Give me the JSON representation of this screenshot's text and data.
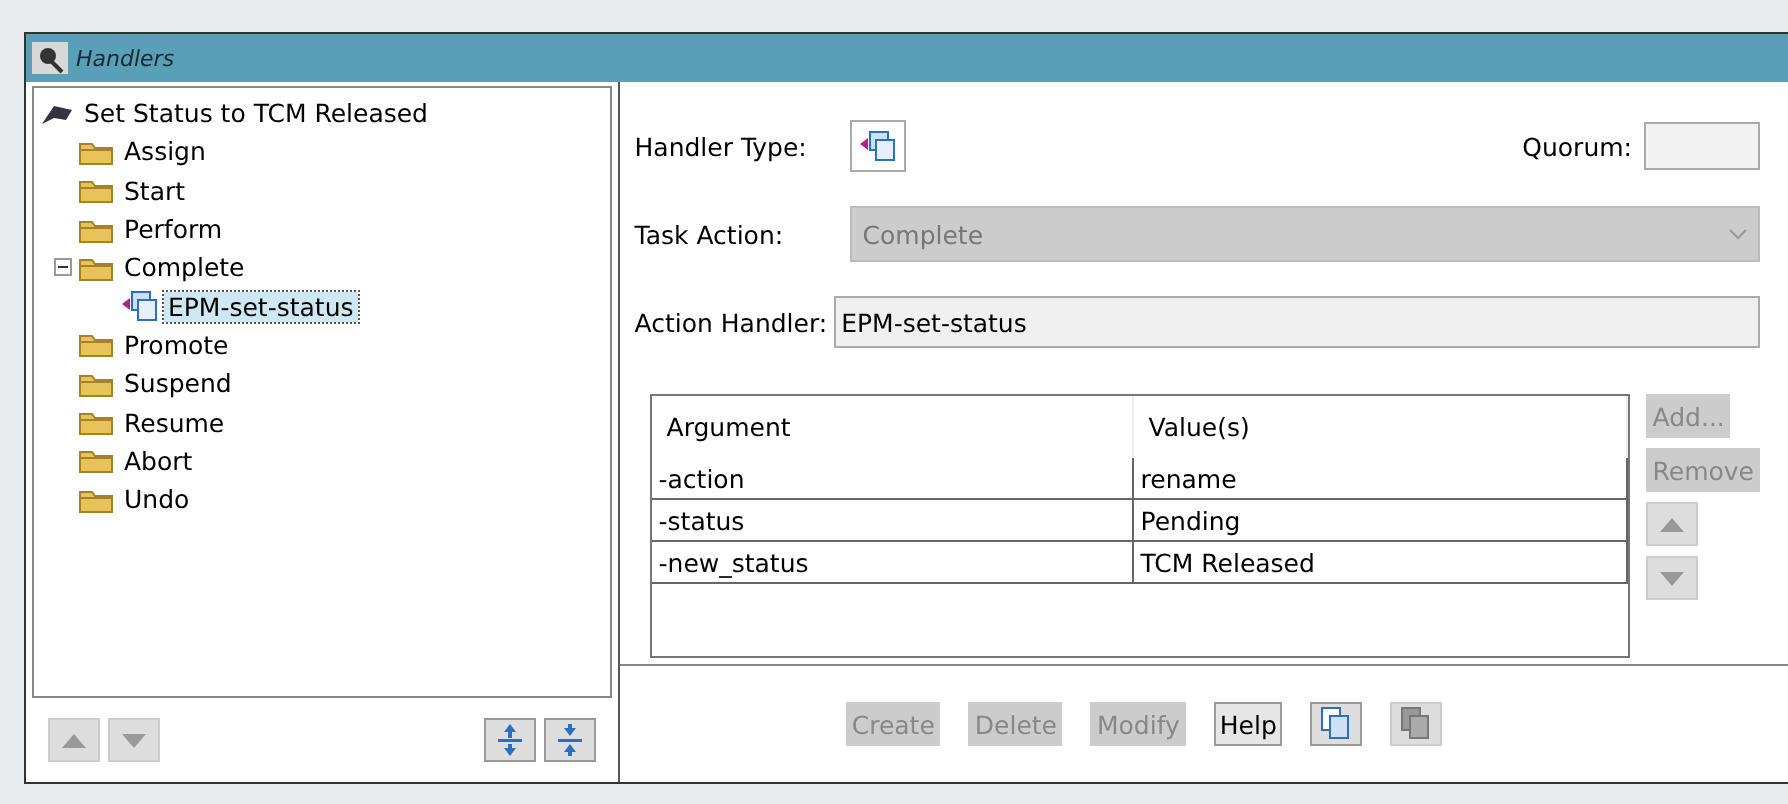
{
  "window": {
    "title": "Handlers"
  },
  "tree": {
    "label": "Set Status to TCM Released",
    "children": [
      {
        "label": "Assign",
        "selected": false
      },
      {
        "label": "Start",
        "selected": false
      },
      {
        "label": "Perform",
        "selected": false
      },
      {
        "label": "Complete",
        "selected": false,
        "expanded": true,
        "children": [
          {
            "label": "EPM-set-status",
            "selected": true,
            "kind": "handler"
          }
        ]
      },
      {
        "label": "Promote",
        "selected": false
      },
      {
        "label": "Suspend",
        "selected": false
      },
      {
        "label": "Resume",
        "selected": false
      },
      {
        "label": "Abort",
        "selected": false
      },
      {
        "label": "Undo",
        "selected": false
      }
    ]
  },
  "tree_buttons": [
    {
      "kind": "up",
      "disabled": true
    },
    {
      "kind": "down",
      "disabled": true
    },
    {
      "kind": "expand",
      "disabled": false
    },
    {
      "kind": "collapse",
      "disabled": false
    }
  ],
  "form": {
    "handler_type_label": "Handler Type:",
    "quorum_label": "Quorum:",
    "task_action_label": "Task Action:",
    "task_action": {
      "value": "Complete",
      "disabled": true
    },
    "action_handler_label": "Action Handler:",
    "action_handler": "EPM-set-status"
  },
  "table": {
    "columns": [
      "Argument",
      "Value(s)"
    ],
    "rows": [
      {
        "cells": [
          "-action",
          "rename"
        ]
      },
      {
        "cells": [
          "-status",
          "Pending"
        ]
      },
      {
        "cells": [
          "-new_status",
          "TCM Released"
        ]
      }
    ]
  },
  "side_buttons": [
    {
      "kind": "text",
      "label": "Add...",
      "disabled": true
    },
    {
      "kind": "text",
      "label": "Remove",
      "disabled": true
    },
    {
      "kind": "up",
      "disabled": true
    },
    {
      "kind": "down",
      "disabled": true
    }
  ],
  "footer_buttons": [
    {
      "kind": "text",
      "label": "Create",
      "disabled": true
    },
    {
      "kind": "text",
      "label": "Delete",
      "disabled": true
    },
    {
      "kind": "text",
      "label": "Modify",
      "disabled": true
    },
    {
      "kind": "text",
      "label": "Help",
      "disabled": false
    },
    {
      "kind": "copy",
      "disabled": false
    },
    {
      "kind": "paste",
      "disabled": true
    }
  ]
}
